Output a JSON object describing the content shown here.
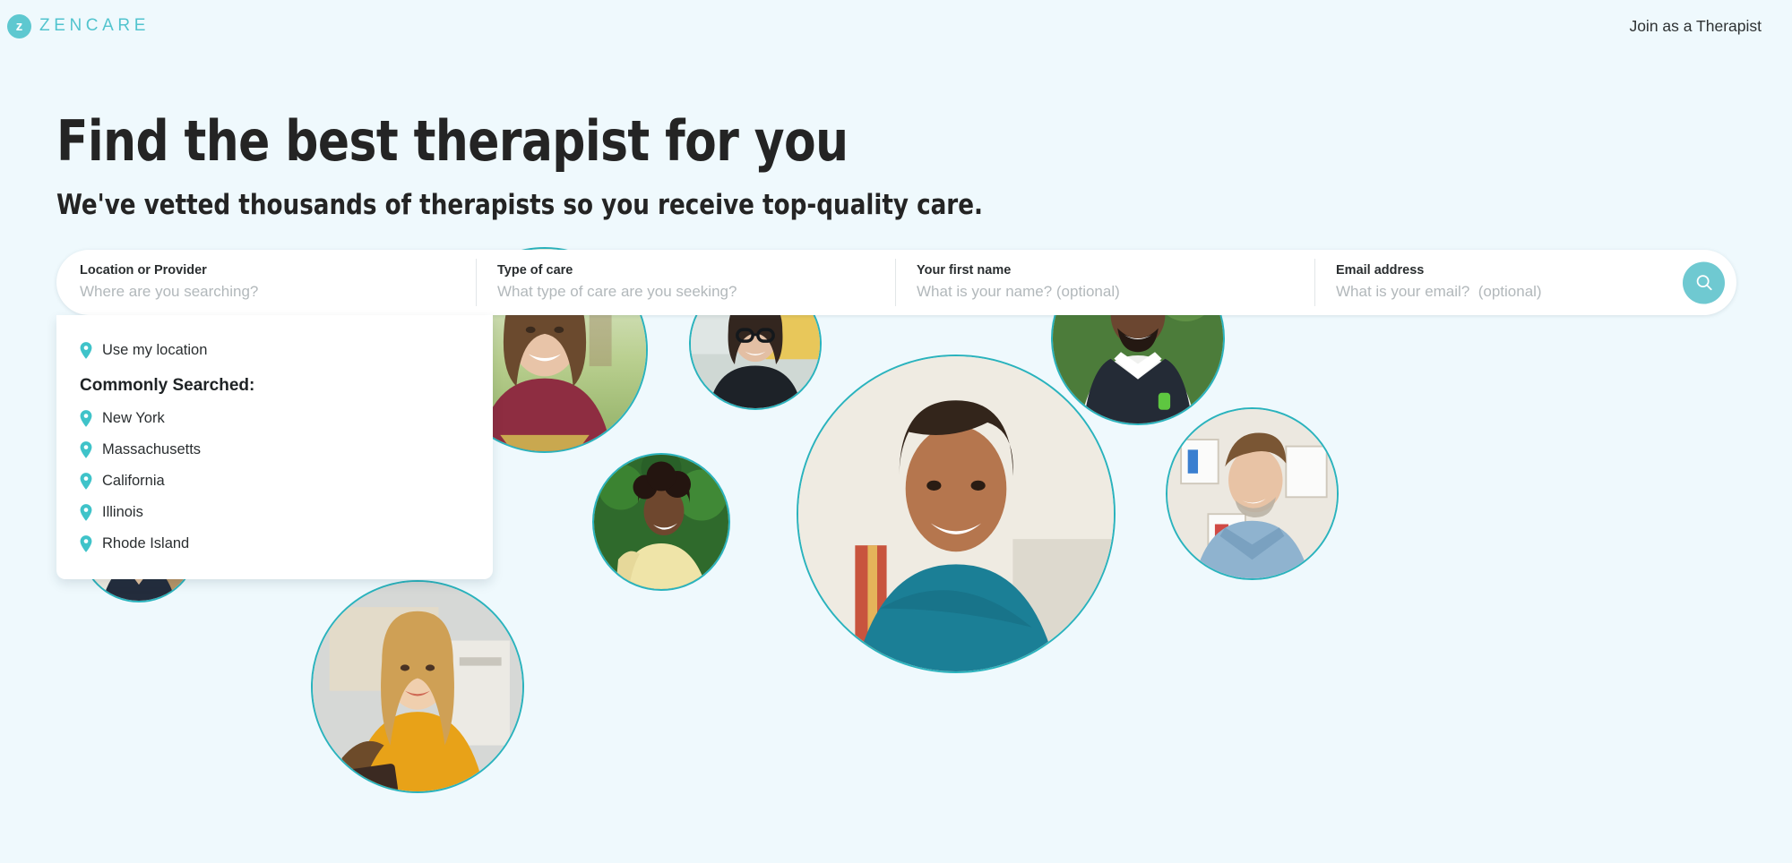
{
  "header": {
    "logo_mark": "z",
    "logo_text": "ZENCARE",
    "join_link": "Join as a Therapist"
  },
  "hero": {
    "title": "Find the best therapist for you",
    "subtitle": "We've vetted thousands of therapists so you receive top-quality care."
  },
  "search": {
    "fields": [
      {
        "label": "Location or Provider",
        "placeholder": "Where are you searching?",
        "value": ""
      },
      {
        "label": "Type of care",
        "placeholder": "What type of care are you seeking?",
        "value": ""
      },
      {
        "label": "Your first name",
        "placeholder": "What is your name? (optional)",
        "value": ""
      },
      {
        "label": "Email address",
        "placeholder": "What is your email?  (optional)",
        "value": ""
      }
    ],
    "button_icon": "search-icon"
  },
  "dropdown": {
    "use_my_location": "Use my location",
    "heading": "Commonly Searched:",
    "items": [
      {
        "label": "New York"
      },
      {
        "label": "Massachusetts"
      },
      {
        "label": "California"
      },
      {
        "label": "Illinois"
      },
      {
        "label": "Rhode Island"
      }
    ]
  },
  "colors": {
    "background": "#eff9fd",
    "brand_teal": "#52c4ce",
    "logo_mark": "#5ec8d0",
    "search_button": "#6fc9d1",
    "photo_border": "#2ab3bd",
    "text_dark": "#242424",
    "placeholder": "#b2b8bb"
  },
  "photos": [
    {
      "name": "therapist-photo-1",
      "alt": "Therapist smiling outdoors in maroon shirt"
    },
    {
      "name": "therapist-photo-2",
      "alt": "Therapist with glasses and curly hair"
    },
    {
      "name": "therapist-photo-3",
      "alt": "Therapist with beard in pinstripe vest"
    },
    {
      "name": "therapist-photo-4",
      "alt": "Therapist in teal top seated on couch"
    },
    {
      "name": "therapist-photo-5",
      "alt": "Therapist in denim shirt in office"
    },
    {
      "name": "therapist-photo-6",
      "alt": "Therapist in yellow shirt holding notebook"
    },
    {
      "name": "therapist-photo-7",
      "alt": "Therapist in yellow blouse with greenery"
    },
    {
      "name": "therapist-photo-8",
      "alt": "Therapist in navy top in bright room"
    },
    {
      "name": "therapist-photo-9",
      "alt": "Partially hidden therapist photo"
    }
  ]
}
